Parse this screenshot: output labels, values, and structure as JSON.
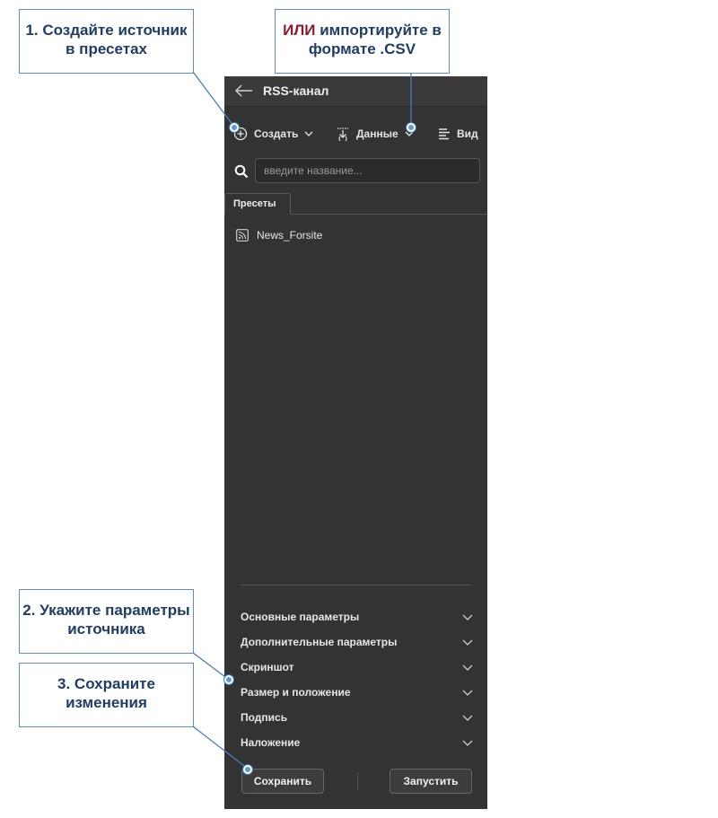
{
  "annotations": {
    "step1": "1. Создайте источник в пресетах",
    "step1_or_accent": "ИЛИ",
    "step1_or_rest": " импортируйте в формате .CSV",
    "step2": "2. Укажите параметры источника",
    "step3": "3. Сохраните изменения"
  },
  "panel": {
    "title": "RSS-канал",
    "toolbar": {
      "create_label": "Создать",
      "data_label": "Данные",
      "view_label": "Вид"
    },
    "search": {
      "placeholder": "введите название..."
    },
    "tabs": [
      {
        "label": "Пресеты"
      }
    ],
    "items": [
      {
        "label": "News_Forsite",
        "icon": "rss-icon"
      }
    ],
    "sections": [
      {
        "label": "Основные параметры"
      },
      {
        "label": "Дополнительные параметры"
      },
      {
        "label": "Скриншот"
      },
      {
        "label": "Размер и положение"
      },
      {
        "label": "Подпись"
      },
      {
        "label": "Наложение"
      }
    ],
    "buttons": {
      "save": "Сохранить",
      "run": "Запустить"
    }
  },
  "colors": {
    "panel_bg": "#333333",
    "callout_border": "#5b8fc9",
    "callout_text": "#1f3d66",
    "accent": "#8b1b2e",
    "dot": "#5b9bd5"
  }
}
